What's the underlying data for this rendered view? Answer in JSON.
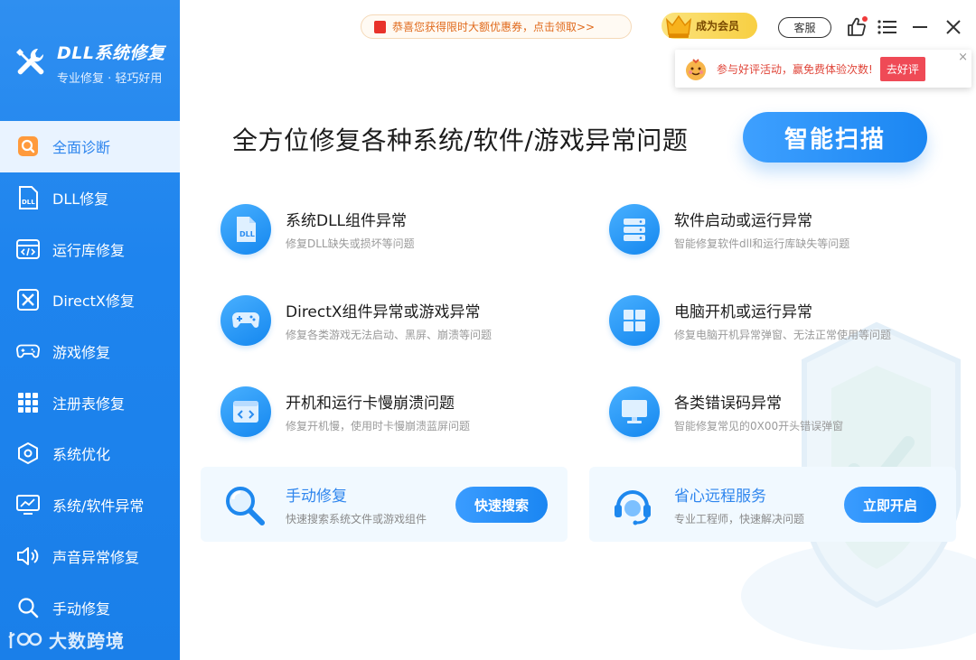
{
  "brand": {
    "title": "DLL系统修复",
    "subtitle": "专业修复 · 轻巧好用"
  },
  "sidebar": {
    "items": [
      {
        "label": "全面诊断",
        "icon": "search-icon",
        "active": true
      },
      {
        "label": "DLL修复",
        "icon": "dll-file-icon"
      },
      {
        "label": "运行库修复",
        "icon": "code-window-icon"
      },
      {
        "label": "DirectX修复",
        "icon": "directx-icon"
      },
      {
        "label": "游戏修复",
        "icon": "gamepad-icon"
      },
      {
        "label": "注册表修复",
        "icon": "grid-icon"
      },
      {
        "label": "系统优化",
        "icon": "hexagon-gear-icon"
      },
      {
        "label": "系统/软件异常",
        "icon": "monitor-icon"
      },
      {
        "label": "声音异常修复",
        "icon": "speaker-icon"
      },
      {
        "label": "手动修复",
        "icon": "search-icon"
      }
    ],
    "watermark": "大数跨境"
  },
  "topbar": {
    "promo": "恭喜您获得限时大额优惠券，点击领取>>",
    "vip": "成为会员",
    "service": "客服"
  },
  "review_popup": {
    "text": "参与好评活动，赢免费体验次数!",
    "button": "去好评",
    "close": "×"
  },
  "main": {
    "headline": "全方位修复各种系统/软件/游戏异常问题",
    "scan_button": "智能扫描",
    "issues": [
      {
        "title": "系统DLL组件异常",
        "desc": "修复DLL缺失或损坏等问题",
        "icon": "dll-file-icon"
      },
      {
        "title": "软件启动或运行异常",
        "desc": "智能修复软件dll和运行库缺失等问题",
        "icon": "server-icon"
      },
      {
        "title": "DirectX组件异常或游戏异常",
        "desc": "修复各类游戏无法启动、黑屏、崩溃等问题",
        "icon": "gamepad-icon"
      },
      {
        "title": "电脑开机或运行异常",
        "desc": "修复电脑开机异常弹窗、无法正常使用等问题",
        "icon": "windows-icon"
      },
      {
        "title": "开机和运行卡慢崩溃问题",
        "desc": "修复开机慢，使用时卡慢崩溃蓝屏问题",
        "icon": "code-window-icon"
      },
      {
        "title": "各类错误码异常",
        "desc": "智能修复常见的0X00开头错误弹窗",
        "icon": "monitor-icon"
      }
    ],
    "cards": [
      {
        "title": "手动修复",
        "desc": "快速搜索系统文件或游戏组件",
        "button": "快速搜索",
        "icon": "magnifier-icon"
      },
      {
        "title": "省心远程服务",
        "desc": "专业工程师，快速解决问题",
        "button": "立即开启",
        "icon": "headset-icon"
      }
    ]
  },
  "colors": {
    "accent": "#1e84ee",
    "active_bg": "#e9f3ff",
    "card_bg": "#f1f9ff",
    "review_red": "#ef4a56"
  }
}
